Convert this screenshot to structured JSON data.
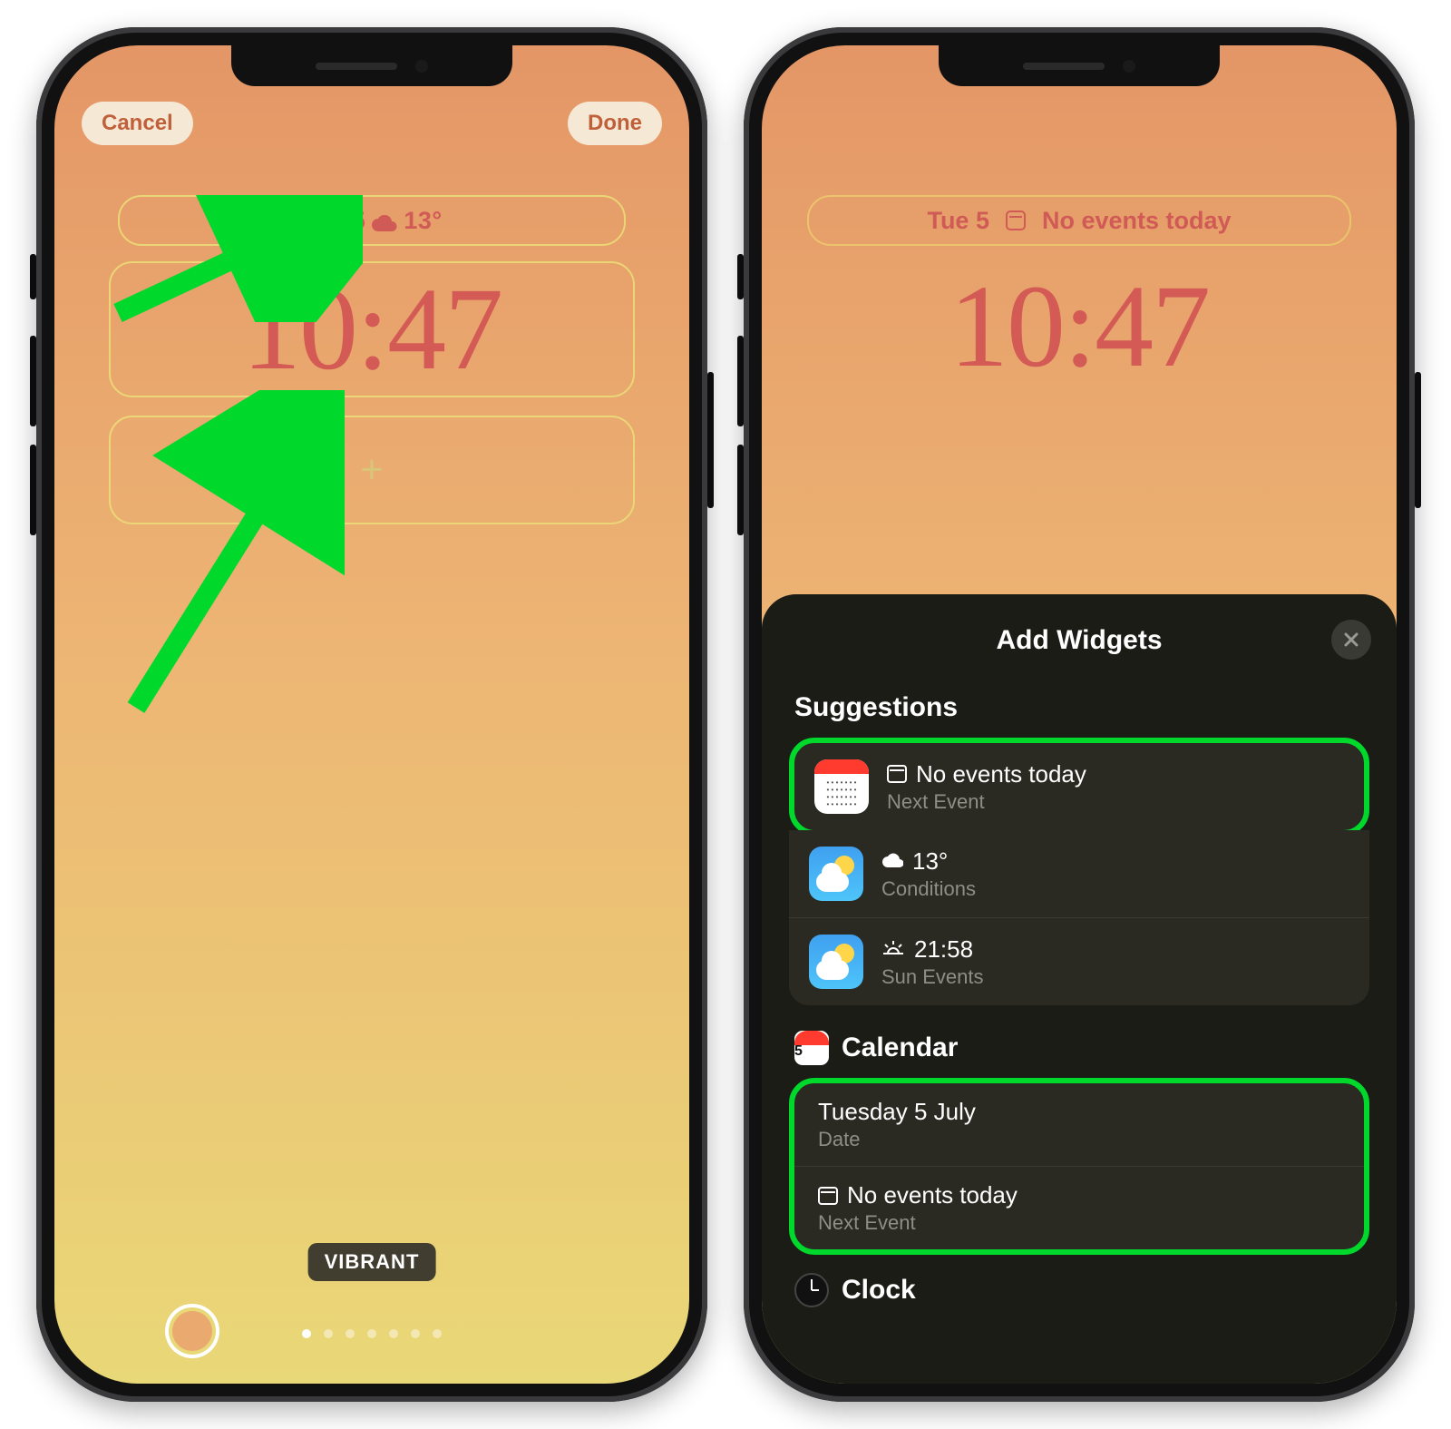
{
  "left": {
    "cancel": "Cancel",
    "done": "Done",
    "topWidget": {
      "date": "Tue 5",
      "temp": "13°"
    },
    "time": "10:47",
    "filterLabel": "VIBRANT"
  },
  "right": {
    "topWidget": {
      "date": "Tue 5",
      "text": "No events today"
    },
    "time": "10:47",
    "sheet": {
      "title": "Add Widgets",
      "suggestionsHeading": "Suggestions",
      "suggestions": [
        {
          "title": "No events today",
          "subtitle": "Next Event",
          "app": "calendar"
        },
        {
          "title": "13°",
          "subtitle": "Conditions",
          "app": "weather"
        },
        {
          "title": "21:58",
          "subtitle": "Sun Events",
          "app": "weather"
        }
      ],
      "calendarSection": {
        "heading": "Calendar",
        "rows": [
          {
            "title": "Tuesday 5 July",
            "subtitle": "Date"
          },
          {
            "title": "No events today",
            "subtitle": "Next Event"
          }
        ]
      },
      "clockSection": {
        "heading": "Clock"
      }
    }
  }
}
